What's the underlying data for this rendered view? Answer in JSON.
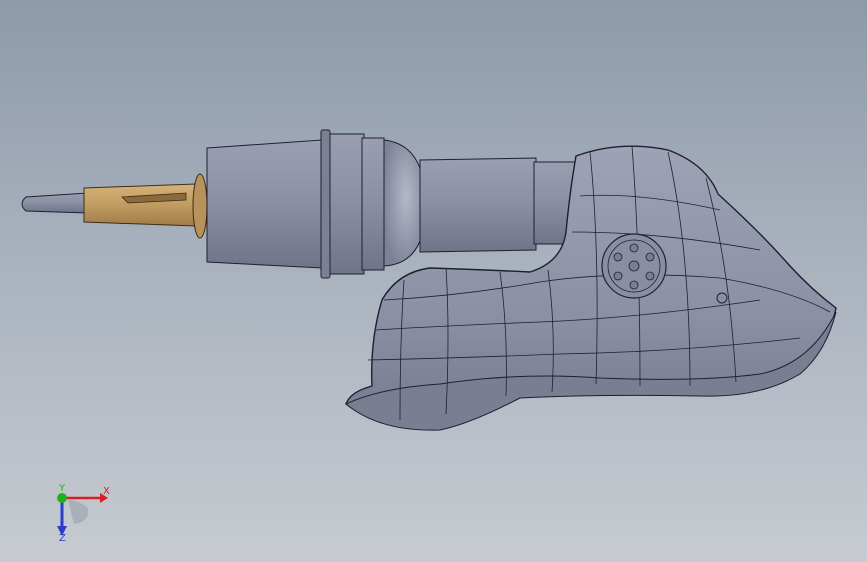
{
  "viewport": {
    "view": "3d-model-viewport",
    "colors": {
      "background_top": "#8e9aaa",
      "background_bottom": "#c7cbd1",
      "model_body": "#8f93a8",
      "model_edge": "#1e2030",
      "brass_part": "#c19b62"
    }
  },
  "triad": {
    "x_label": "X",
    "y_label": "Y",
    "z_label": "Z",
    "colors": {
      "x": "#d42020",
      "y": "#1fb01f",
      "z": "#2a3cc8"
    }
  }
}
